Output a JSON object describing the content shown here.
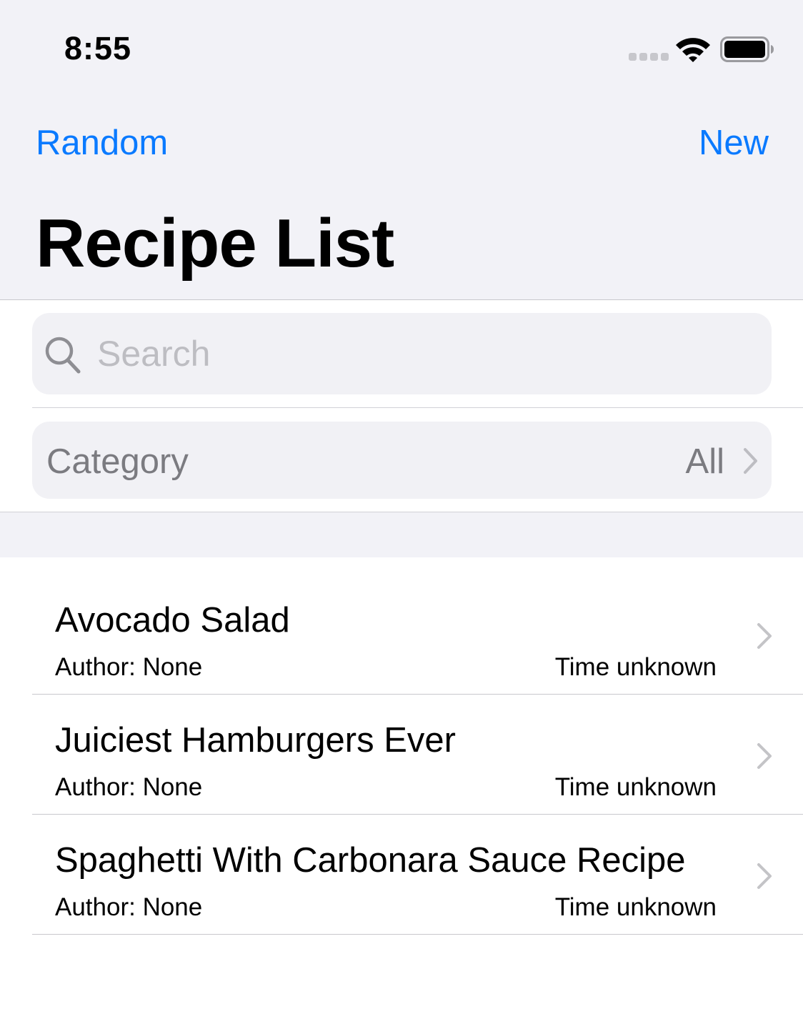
{
  "status_bar": {
    "time": "8:55"
  },
  "nav": {
    "left_label": "Random",
    "right_label": "New",
    "title": "Recipe List"
  },
  "search": {
    "placeholder": "Search",
    "value": ""
  },
  "category": {
    "label": "Category",
    "value": "All"
  },
  "recipes": [
    {
      "title": "Avocado Salad",
      "author": "Author: None",
      "time": "Time unknown"
    },
    {
      "title": "Juiciest Hamburgers Ever",
      "author": "Author: None",
      "time": "Time unknown"
    },
    {
      "title": "Spaghetti With Carbonara Sauce Recipe",
      "author": "Author: None",
      "time": "Time unknown"
    }
  ],
  "colors": {
    "accent": "#0a7aff",
    "grouped_background": "#f2f2f7",
    "field_background": "#f1f1f5",
    "secondary_text": "#7b7b80",
    "chevron": "#c4c4c7"
  },
  "icons": {
    "signal": "cellular-signal-icon",
    "wifi": "wifi-icon",
    "battery": "battery-icon",
    "search": "search-icon",
    "disclosure": "chevron-right-icon"
  }
}
